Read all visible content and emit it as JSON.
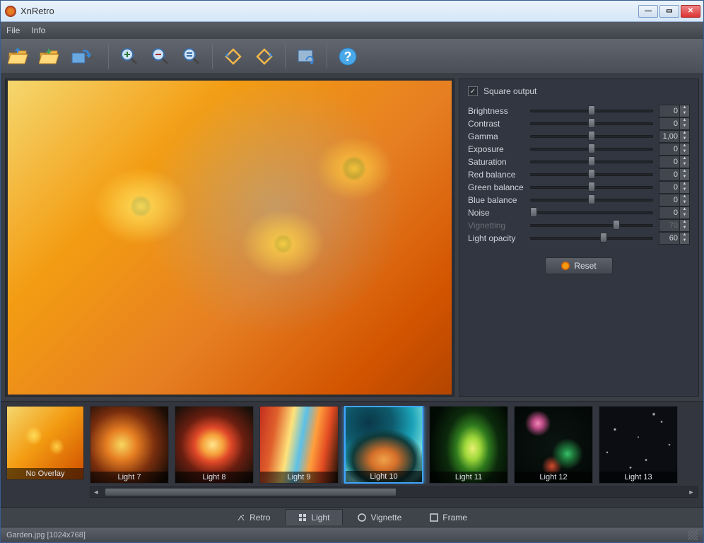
{
  "window": {
    "title": "XnRetro"
  },
  "menu": {
    "file": "File",
    "info": "Info"
  },
  "panel": {
    "square_output": {
      "label": "Square output",
      "checked": true
    },
    "sliders": [
      {
        "key": "brightness",
        "label": "Brightness",
        "value": "0",
        "pos": 50,
        "disabled": false
      },
      {
        "key": "contrast",
        "label": "Contrast",
        "value": "0",
        "pos": 50,
        "disabled": false
      },
      {
        "key": "gamma",
        "label": "Gamma",
        "value": "1,00",
        "pos": 50,
        "disabled": false
      },
      {
        "key": "exposure",
        "label": "Exposure",
        "value": "0",
        "pos": 50,
        "disabled": false
      },
      {
        "key": "saturation",
        "label": "Saturation",
        "value": "0",
        "pos": 50,
        "disabled": false
      },
      {
        "key": "red_balance",
        "label": "Red balance",
        "value": "0",
        "pos": 50,
        "disabled": false
      },
      {
        "key": "green_balance",
        "label": "Green balance",
        "value": "0",
        "pos": 50,
        "disabled": false
      },
      {
        "key": "blue_balance",
        "label": "Blue balance",
        "value": "0",
        "pos": 50,
        "disabled": false
      },
      {
        "key": "noise",
        "label": "Noise",
        "value": "0",
        "pos": 3,
        "disabled": false
      },
      {
        "key": "vignetting",
        "label": "Vignetting",
        "value": "70",
        "pos": 70,
        "disabled": true
      },
      {
        "key": "light_opacity",
        "label": "Light opacity",
        "value": "60",
        "pos": 60,
        "disabled": false
      }
    ],
    "reset": "Reset"
  },
  "overlays": {
    "no_overlay": "No Overlay",
    "items": [
      {
        "label": "Light 7",
        "cls": "l7",
        "selected": false
      },
      {
        "label": "Light 8",
        "cls": "l8",
        "selected": false
      },
      {
        "label": "Light 9",
        "cls": "l9",
        "selected": false
      },
      {
        "label": "Light 10",
        "cls": "l10",
        "selected": true
      },
      {
        "label": "Light 11",
        "cls": "l11",
        "selected": false
      },
      {
        "label": "Light 12",
        "cls": "l12",
        "selected": false
      },
      {
        "label": "Light 13",
        "cls": "l13",
        "selected": false
      }
    ]
  },
  "tabs": [
    {
      "key": "retro",
      "label": "Retro",
      "active": false
    },
    {
      "key": "light",
      "label": "Light",
      "active": true
    },
    {
      "key": "vignette",
      "label": "Vignette",
      "active": false
    },
    {
      "key": "frame",
      "label": "Frame",
      "active": false
    }
  ],
  "status": {
    "text": "Garden.jpg [1024x768]"
  }
}
